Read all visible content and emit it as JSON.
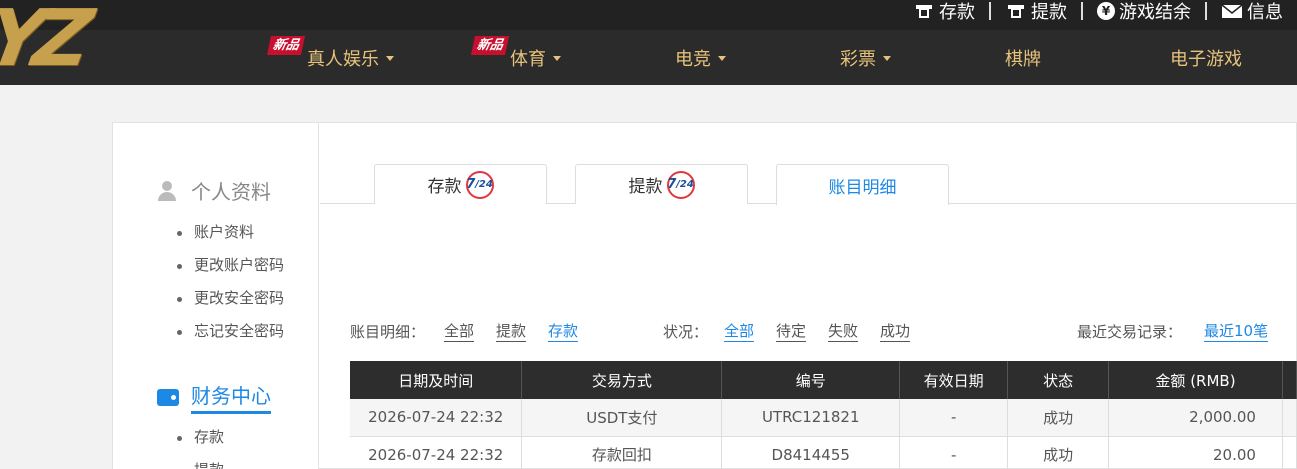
{
  "top_links": [
    {
      "label": "存款",
      "icon": "deposit-icon"
    },
    {
      "label": "提款",
      "icon": "withdraw-icon"
    },
    {
      "label": "游戏结余",
      "icon": "yen-icon"
    },
    {
      "label": "信息",
      "icon": "mail-icon"
    }
  ],
  "logo": {
    "text": "YZ"
  },
  "nav": [
    {
      "label": "真人娱乐",
      "badge": "新品",
      "dropdown": true
    },
    {
      "label": "体育",
      "badge": "新品",
      "dropdown": true
    },
    {
      "label": "电竞",
      "dropdown": true
    },
    {
      "label": "彩票",
      "dropdown": true
    },
    {
      "label": "棋牌",
      "dropdown": false
    },
    {
      "label": "电子游戏",
      "dropdown": false
    }
  ],
  "sidebar": {
    "profile": {
      "title": "个人资料",
      "items": [
        "账户资料",
        "更改账户密码",
        "更改安全密码",
        "忘记安全密码"
      ]
    },
    "finance": {
      "title": "财务中心",
      "items": [
        "存款",
        "提款"
      ]
    }
  },
  "tabs": [
    {
      "label": "存款",
      "badge": "7/24"
    },
    {
      "label": "提款",
      "badge": "7/24"
    },
    {
      "label": "账目明细",
      "active": true
    }
  ],
  "filters": {
    "detail_label": "账目明细：",
    "detail_options": [
      "全部",
      "提款",
      "存款"
    ],
    "detail_selected": "存款",
    "status_label": "状况：",
    "status_options": [
      "全部",
      "待定",
      "失败",
      "成功"
    ],
    "status_selected": "全部",
    "recent_label": "最近交易记录：",
    "recent_option": "最近10笔"
  },
  "table": {
    "headers": [
      "日期及时间",
      "交易方式",
      "编号",
      "有效日期",
      "状态",
      "金额 (RMB)"
    ],
    "rows": [
      [
        "2026-07-24 22:32",
        "USDT支付",
        "UTRC121821",
        "-",
        "成功",
        "2,000.00"
      ],
      [
        "2026-07-24 22:32",
        "存款回扣",
        "D8414455",
        "-",
        "成功",
        "20.00"
      ]
    ]
  },
  "colors": {
    "accent": "#1e88e5",
    "gold": "#e6c27a",
    "header": "#2b2b2b",
    "badge": "#c8102e"
  }
}
